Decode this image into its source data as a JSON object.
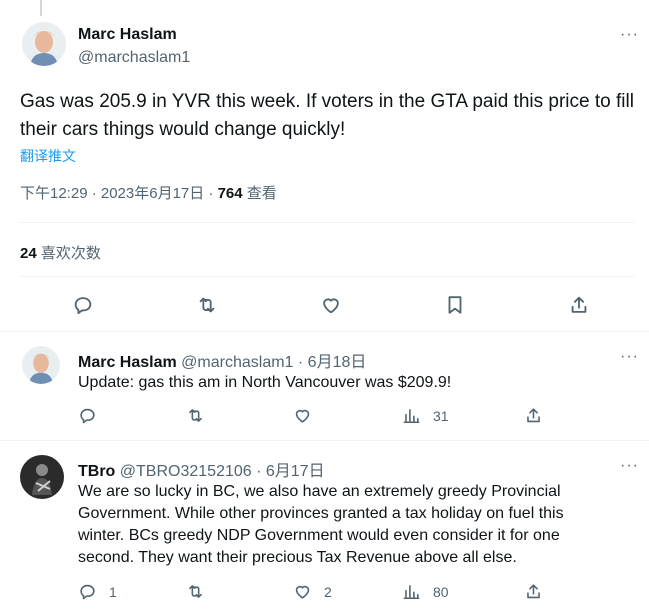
{
  "main_tweet": {
    "author_name": "Marc Haslam",
    "author_handle": "@marchaslam1",
    "more": "···",
    "text": "Gas was 205.9 in YVR this week. If voters in the GTA paid this price to fill their cars things would change quickly!",
    "translate": "翻译推文",
    "time": "下午12:29 · 2023年6月17日 · ",
    "views_count": "764",
    "views_label": " 查看",
    "likes_count": "24",
    "likes_label": " 喜欢次数"
  },
  "replies": [
    {
      "author_name": "Marc Haslam",
      "author_handle": "@marchaslam1 · 6月18日",
      "more": "···",
      "text": "Update: gas this am in North Vancouver was $209.9!",
      "reply_count": "",
      "retweet_count": "",
      "like_count": "",
      "view_count": "31"
    },
    {
      "author_name": "TBro",
      "author_handle": "@TBRO32152106 · 6月17日",
      "more": "···",
      "text": "We are so lucky in BC, we also have an extremely greedy Provincial Government. While other provinces granted a tax holiday on fuel this winter. BCs greedy NDP Government would even consider it for one second. They want their precious Tax Revenue above all else.",
      "reply_count": "1",
      "retweet_count": "",
      "like_count": "2",
      "view_count": "80"
    }
  ],
  "icons": [
    "reply-icon",
    "retweet-icon",
    "like-icon",
    "bookmark-icon",
    "share-icon",
    "views-icon"
  ],
  "colors": {
    "text": "#0f1419",
    "secondary": "#536471",
    "link": "#1d9bf0",
    "divider": "#eff3f4"
  }
}
